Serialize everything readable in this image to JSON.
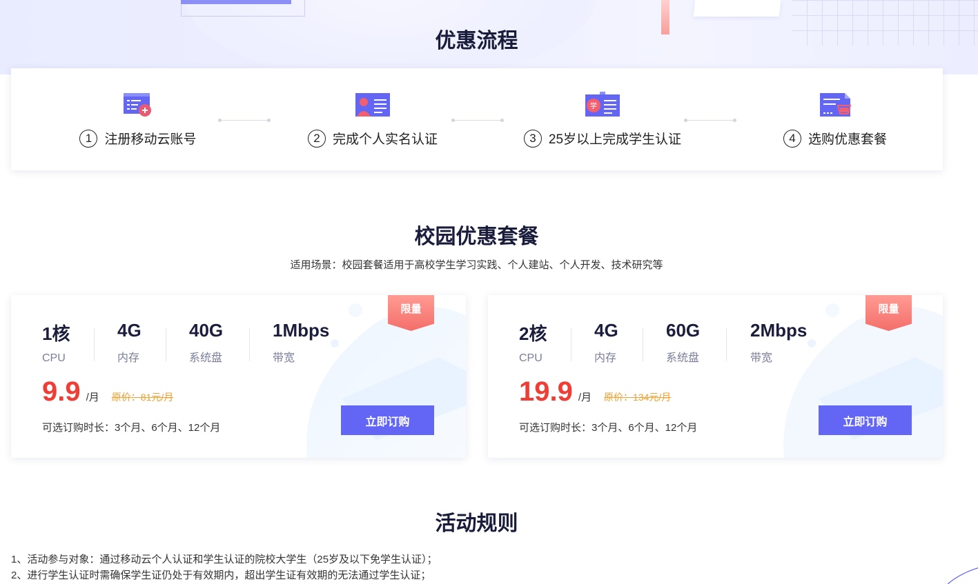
{
  "flow": {
    "title": "优惠流程",
    "steps": [
      {
        "num": "1",
        "label": "注册移动云账号",
        "icon": "register-account-icon"
      },
      {
        "num": "2",
        "label": "完成个人实名认证",
        "icon": "id-card-icon"
      },
      {
        "num": "3",
        "label": "25岁以上完成学生认证",
        "icon": "student-card-icon"
      },
      {
        "num": "4",
        "label": "选购优惠套餐",
        "icon": "shopping-cart-icon"
      }
    ]
  },
  "packages": {
    "title": "校园优惠套餐",
    "subtitle": "适用场景：校园套餐适用于高校学生学习实践、个人建站、个人开发、技术研究等",
    "items": [
      {
        "badge": "限量",
        "specs": [
          {
            "value": "1核",
            "label": "CPU"
          },
          {
            "value": "4G",
            "label": "内存"
          },
          {
            "value": "40G",
            "label": "系统盘"
          },
          {
            "value": "1Mbps",
            "label": "带宽"
          }
        ],
        "price": "9.9",
        "unit": "/月",
        "original": "原价：81元/月",
        "duration": "可选订购时长：3个月、6个月、12个月",
        "buy_label": "立即订购"
      },
      {
        "badge": "限量",
        "specs": [
          {
            "value": "2核",
            "label": "CPU"
          },
          {
            "value": "4G",
            "label": "内存"
          },
          {
            "value": "60G",
            "label": "系统盘"
          },
          {
            "value": "2Mbps",
            "label": "带宽"
          }
        ],
        "price": "19.9",
        "unit": "/月",
        "original": "原价：134元/月",
        "duration": "可选订购时长：3个月、6个月、12个月",
        "buy_label": "立即订购"
      }
    ]
  },
  "rules": {
    "title": "活动规则",
    "items": [
      "1、活动参与对象：通过移动云个人认证和学生认证的院校大学生（25岁及以下免学生认证）；",
      "2、进行学生认证时需确保学生证仍处于有效期内，超出学生证有效期的无法通过学生认证；"
    ]
  },
  "colors": {
    "accent": "#6366f5",
    "price": "#ee3e36",
    "original_price": "#f0a030",
    "badge": "#f46e6a"
  }
}
